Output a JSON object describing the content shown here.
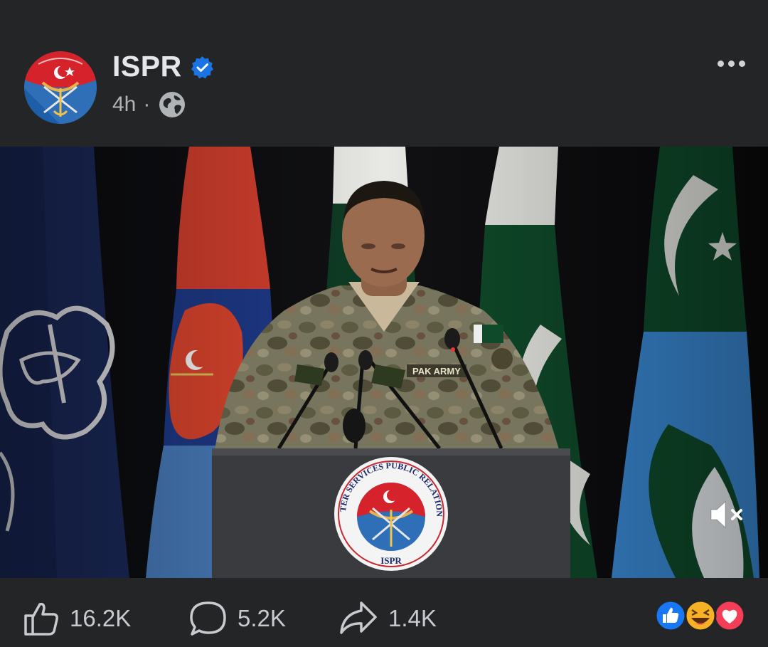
{
  "post": {
    "page_name": "ISPR",
    "time": "4h",
    "separator": "·",
    "verified": true,
    "privacy_icon": "globe-icon",
    "menu_icon": "more-options-icon"
  },
  "video": {
    "podium_logo": {
      "arc_text": "INTER SERVICES PUBLIC RELATIONS",
      "bottom_text": "ISPR"
    },
    "nameplate": "PAK ARMY",
    "mute_icon": "speaker-muted-icon"
  },
  "footer": {
    "likes": "16.2K",
    "comments": "5.2K",
    "shares": "1.4K",
    "reaction_icons": [
      "like-reaction-icon",
      "haha-reaction-icon",
      "love-reaction-icon"
    ]
  },
  "colors": {
    "background": "#242526",
    "text_primary": "#e4e6eb",
    "text_secondary": "#b0b3b8",
    "verified_blue": "#1b74e4",
    "like_blue": "#1877f2",
    "love_red": "#f33e58",
    "haha_yellow": "#f7b125"
  }
}
